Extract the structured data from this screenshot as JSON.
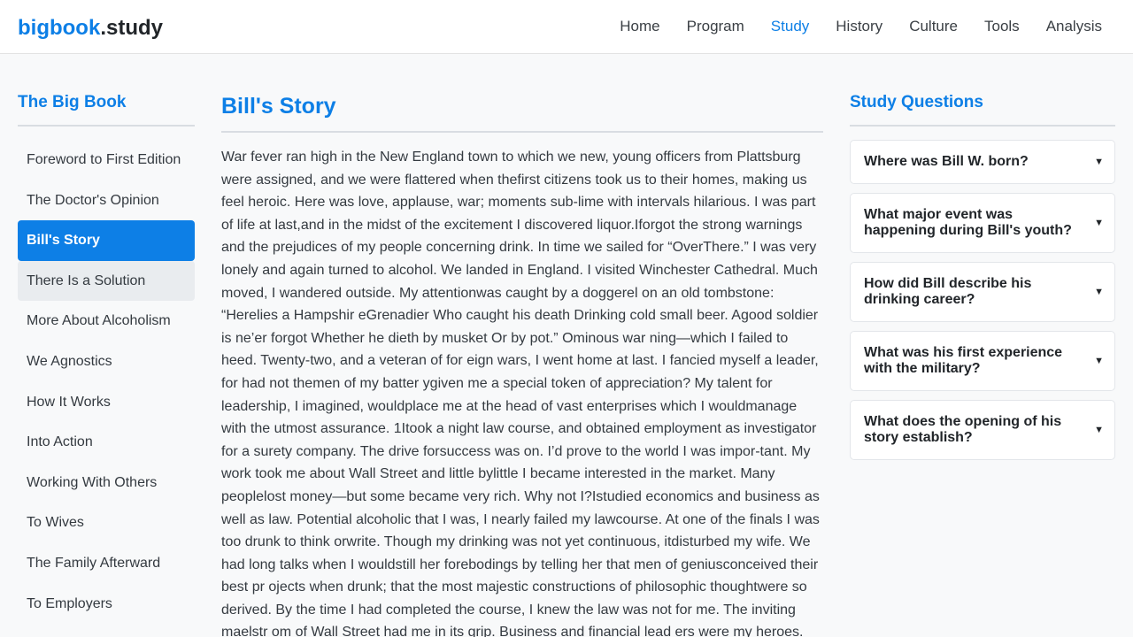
{
  "brand": {
    "accent": "bigbook",
    "rest": ".study"
  },
  "nav": [
    {
      "label": "Home"
    },
    {
      "label": "Program"
    },
    {
      "label": "Study",
      "active": true
    },
    {
      "label": "History"
    },
    {
      "label": "Culture"
    },
    {
      "label": "Tools"
    },
    {
      "label": "Analysis"
    }
  ],
  "sidebar": {
    "title": "The Big Book",
    "items": [
      {
        "label": "Foreword to First Edition"
      },
      {
        "label": "The Doctor's Opinion"
      },
      {
        "label": "Bill's Story",
        "state": "active"
      },
      {
        "label": "There Is a Solution",
        "state": "hover"
      },
      {
        "label": "More About Alcoholism"
      },
      {
        "label": "We Agnostics"
      },
      {
        "label": "How It Works"
      },
      {
        "label": "Into Action"
      },
      {
        "label": "Working With Others"
      },
      {
        "label": "To Wives"
      },
      {
        "label": "The Family Afterward"
      },
      {
        "label": "To Employers"
      }
    ]
  },
  "main": {
    "title": "Bill's Story",
    "text": "War fever ran high in the New England town to which we new, young officers from Plattsburg were assigned, and we were flattered when thefirst citizens took us to their homes, making us feel heroic. Here was love, applause, war; moments sub-lime with intervals hilarious. I was part of life at last,and in the midst of the excitement I discovered liquor.Iforgot the strong warnings and the prejudices of my people concerning drink. In time we sailed for “OverThere.” I was very lonely and again turned to alcohol. We landed in England. I visited Winchester Cathedral. Much moved, I wandered outside. My attentionwas caught by a doggerel on an old tombstone: “Herelies a Hampshir eGrenadier Who caught his death Drinking cold small beer. Agood soldier is ne’er forgot Whether he dieth by musket Or by pot.” Ominous war ning—which I failed to heed. Twenty-two, and a veteran of for eign wars, I went home at last. I fancied myself a leader, for had not themen of my batter ygiven me a special token of appreciation? My talent for leadership, I imagined, wouldplace me at the head of vast enterprises which I wouldmanage with the utmost assurance. 1Itook a night law course, and obtained employment as investigator for a surety company. The drive forsuccess was on. I’d prove to the world I was impor-tant. My work took me about Wall Street and little bylittle I became interested in the market. Many peoplelost money—but some became very rich. Why not I?Istudied economics and business as well as law. Potential alcoholic that I was, I nearly failed my lawcourse. At one of the finals I was too drunk to think orwrite. Though my drinking was not yet continuous, itdisturbed my wife. We had long talks when I wouldstill her forebodings by telling her that men of geniusconceived their best pr ojects when drunk; that the most majestic constructions of philosophic thoughtwere so derived. By the time I had completed the course, I knew the law was not for me. The inviting maelstr om of Wall Street had me in its grip. Business and financial lead ers were my heroes."
  },
  "study": {
    "title": "Study Questions",
    "questions": [
      {
        "text": "Where was Bill W. born?",
        "icon": "triangle-down-icon"
      },
      {
        "text": "What major event was happening during Bill's youth?",
        "icon": "triangle-down-icon"
      },
      {
        "text": "How did Bill describe his drinking career?",
        "icon": "triangle-down-icon"
      },
      {
        "text": "What was his first experience with the military?",
        "icon": "triangle-down-icon"
      },
      {
        "text": "What does the opening of his story establish?",
        "icon": "triangle-down-icon"
      }
    ]
  },
  "colors": {
    "accent": "#0d7fe6",
    "background": "#f8f9fa",
    "hover": "#e9ecef"
  }
}
